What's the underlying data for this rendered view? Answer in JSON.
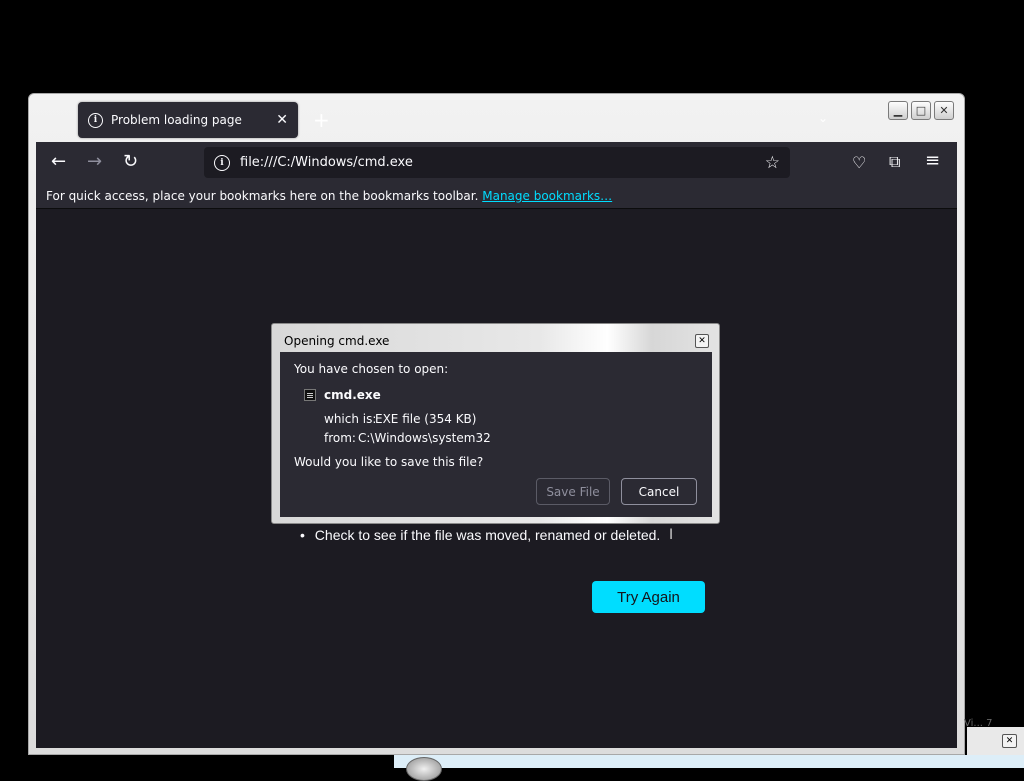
{
  "window": {
    "minimize_glyph": "▁",
    "maximize_glyph": "□",
    "close_glyph": "✕"
  },
  "tab": {
    "title": "Problem loading page",
    "info_icon": "info-icon",
    "close_glyph": "✕"
  },
  "tabstrip": {
    "new_tab_glyph": "+",
    "list_all_glyph": "⌄"
  },
  "toolbar": {
    "back_glyph": "←",
    "forward_glyph": "→",
    "reload_glyph": "↻",
    "url": "file:///C:/Windows/cmd.exe",
    "bookmark_glyph": "☆",
    "pocket_glyph": "♡",
    "extensions_glyph": "⧉",
    "menu_glyph": "≡"
  },
  "bookmarks_bar": {
    "message": "For quick access, place your bookmarks here on the bookmarks toolbar.",
    "link": "Manage bookmarks…"
  },
  "page": {
    "bullet": "•",
    "bullet_text": "Check to see if the file was moved, renamed or deleted.",
    "try_again": "Try Again"
  },
  "dialog": {
    "title": "Opening cmd.exe",
    "close_glyph": "✕",
    "intro": "You have chosen to open:",
    "file_name": "cmd.exe",
    "which_is_label": "which is:",
    "which_is_value": "EXE file (354 KB)",
    "from_label": "from:",
    "from_value": "C:\\Windows\\system32",
    "question": "Would you like to save this file?",
    "save_label": "Save File",
    "cancel_label": "Cancel"
  },
  "misc": {
    "cursor_glyph": "I",
    "stray_text": "Vi... 7",
    "side_close_glyph": "✕"
  },
  "colors": {
    "accent": "#00ddff",
    "chrome_bg": "#2b2a33",
    "page_bg": "#1c1b22"
  }
}
